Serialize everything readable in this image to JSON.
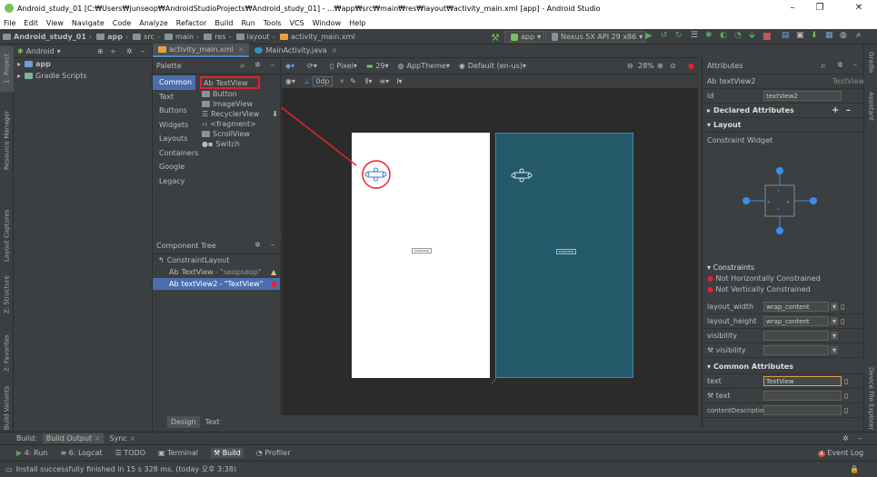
{
  "window": {
    "title": "Android_study_01 [C:₩Users₩junseop₩AndroidStudioProjects₩Android_study_01] - ...₩app₩src₩main₩res₩layout₩activity_main.xml [app] - Android Studio",
    "minimize": "–",
    "maximize": "❐",
    "close": "✕"
  },
  "menu": [
    "File",
    "Edit",
    "View",
    "Navigate",
    "Code",
    "Analyze",
    "Refactor",
    "Build",
    "Run",
    "Tools",
    "VCS",
    "Window",
    "Help"
  ],
  "breadcrumb": [
    "Android_study_01",
    "app",
    "src",
    "main",
    "res",
    "layout",
    "activity_main.xml"
  ],
  "toolbar": {
    "run_config": "app",
    "device": "Nexus 5X API 29 x86"
  },
  "project": {
    "view_mode": "Android",
    "items": [
      "app",
      "Gradle Scripts"
    ]
  },
  "editor_tabs": [
    "activity_main.xml",
    "MainActivity.java"
  ],
  "palette": {
    "title": "Palette",
    "categories": [
      "Common",
      "Text",
      "Buttons",
      "Widgets",
      "Layouts",
      "Containers",
      "Google",
      "Legacy"
    ],
    "items": [
      "TextView",
      "Button",
      "ImageView",
      "RecyclerView",
      "<fragment>",
      "ScrollView",
      "Switch"
    ]
  },
  "canvas": {
    "device": "Pixel",
    "api": "29",
    "theme": "AppTheme",
    "locale": "Default (en-us)",
    "zoom": "28%",
    "margin": "0dp",
    "design_textview_label": "seopseop",
    "blueprint_textview_label": "seopseop"
  },
  "component_tree": {
    "title": "Component Tree",
    "root": "ConstraintLayout",
    "children": [
      {
        "name": "TextView",
        "value": "- \"seopseop\"",
        "status": "warning"
      },
      {
        "name": "textView2",
        "value": "- \"TextView\"",
        "status": "error"
      }
    ]
  },
  "design_tabs": [
    "Design",
    "Text"
  ],
  "attributes": {
    "title": "Attributes",
    "selected": "textView2",
    "selected_type": "TextView",
    "id_label": "id",
    "id_value": "textView2",
    "declared": "Declared Attributes",
    "layout": "Layout",
    "constraint_widget": "Constraint Widget",
    "constraints_title": "Constraints",
    "constraint_errors": [
      "Not Horizontally Constrained",
      "Not Vertically Constrained"
    ],
    "layout_width_label": "layout_width",
    "layout_width": "wrap_content",
    "layout_height_label": "layout_height",
    "layout_height": "wrap_content",
    "visibility_label": "visibility",
    "visibility2_label": "visibility",
    "common": "Common Attributes",
    "text_label": "text",
    "text_value": "TextView",
    "text2_label": "text",
    "content_desc_label": "contentDescription"
  },
  "bottom": {
    "build_tab": "Build:",
    "build_output": "Build Output",
    "sync": "Sync"
  },
  "tool_windows": [
    "4: Run",
    "6: Logcat",
    "TODO",
    "Terminal",
    "Build",
    "Profiler"
  ],
  "event_log": "Event Log",
  "event_count": "4",
  "status": "Install successfully finished in 15 s 328 ms. (today 오후 3:38)",
  "left_tabs": [
    "1: Project",
    "Resource Manager",
    "Layout Captures",
    "Z: Structure",
    "2: Favorites",
    "Build Variants"
  ],
  "right_tabs": [
    "Gradle",
    "Assistant",
    "Device File Explorer"
  ],
  "colors": {
    "accent": "#4b6eaf",
    "highlight": "#e8202a",
    "blueprint": "#24596a"
  }
}
